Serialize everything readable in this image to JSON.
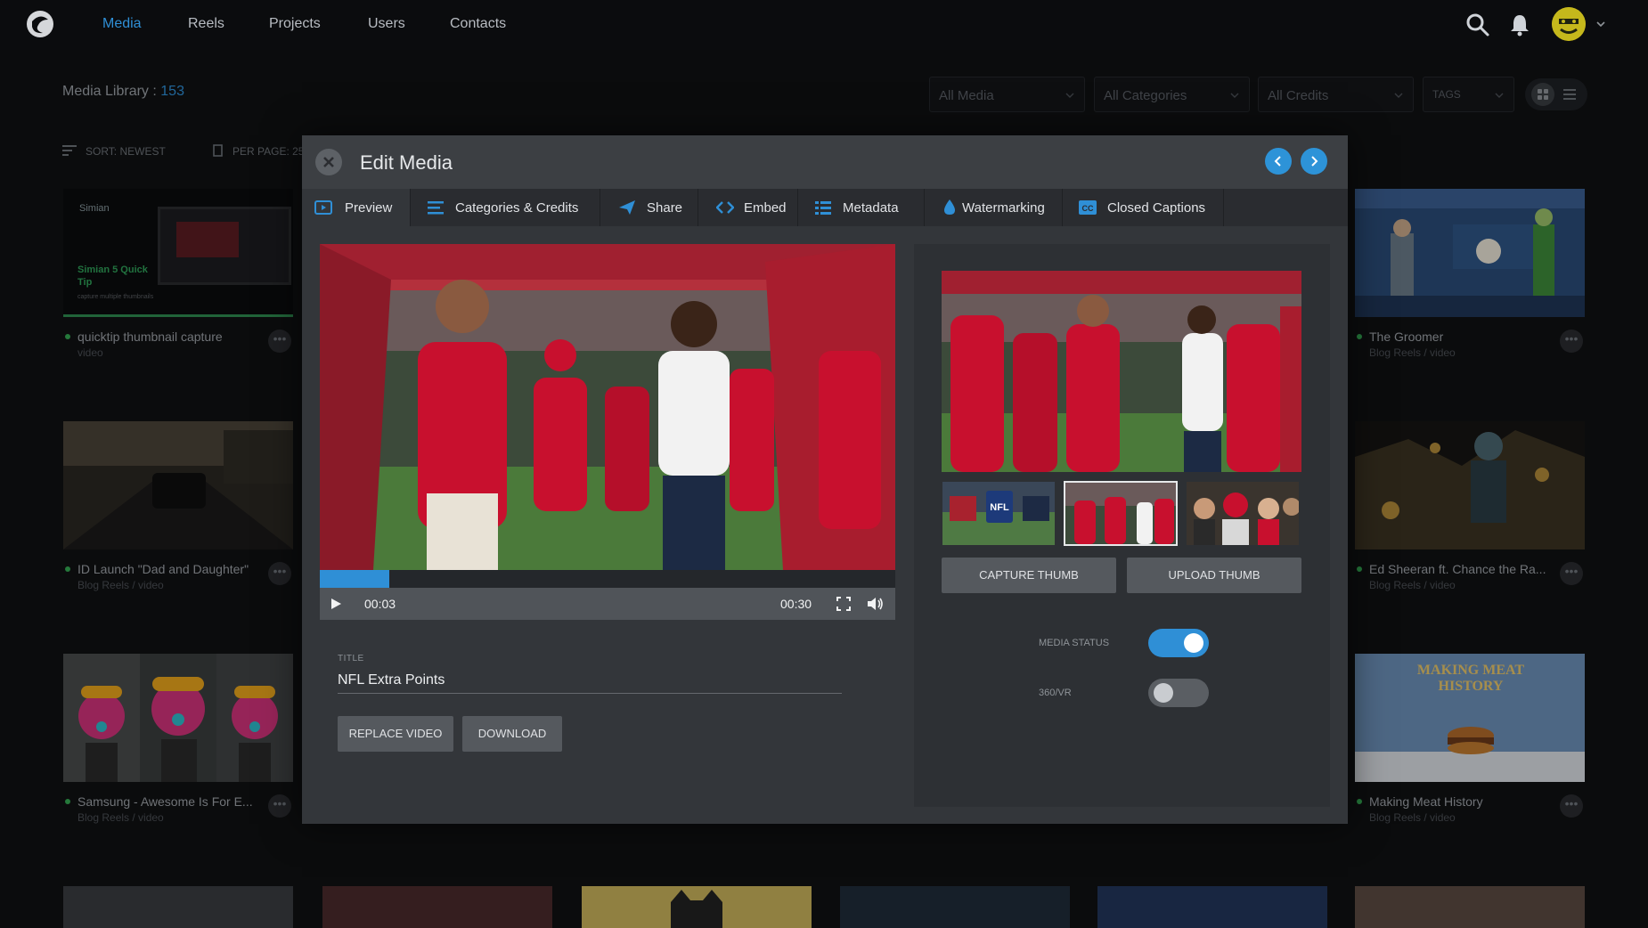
{
  "nav": {
    "items": [
      "Media",
      "Reels",
      "Projects",
      "Users",
      "Contacts"
    ],
    "active": "Media"
  },
  "library": {
    "title": "Media Library",
    "separator": " : ",
    "count": "153",
    "sort": "SORT: NEWEST",
    "per_page": "PER PAGE: 25",
    "filters": [
      "All Media",
      "All Categories",
      "All Credits",
      "TAGS"
    ]
  },
  "cards": {
    "left": [
      {
        "title": "quicktip thumbnail capture",
        "subtitle": "video",
        "thumb_text": "Simian 5 Quick Tip",
        "thumb_caption": "capture multiple thumbnails",
        "brand": "Simian"
      },
      {
        "title": "ID Launch \"Dad and Daughter\"",
        "subtitle": "Blog Reels / video"
      },
      {
        "title": "Samsung - Awesome Is For E...",
        "subtitle": "Blog Reels / video"
      }
    ],
    "right": [
      {
        "title": "The Groomer",
        "subtitle": "Blog Reels / video"
      },
      {
        "title": "Ed Sheeran ft. Chance the Ra...",
        "subtitle": "Blog Reels / video"
      },
      {
        "title": "Making Meat History",
        "subtitle": "Blog Reels / video",
        "thumb_text": "MAKING MEAT HISTORY"
      }
    ],
    "more_glyph": "•••"
  },
  "modal": {
    "title": "Edit Media",
    "tabs": [
      "Preview",
      "Categories & Credits",
      "Share",
      "Embed",
      "Metadata",
      "Watermarking",
      "Closed Captions"
    ],
    "active_tab": "Preview",
    "player": {
      "current_time": "00:03",
      "duration": "00:30",
      "progress": 0.12
    },
    "form": {
      "title_label": "TITLE",
      "title_value": "NFL Extra Points",
      "replace_label": "REPLACE VIDEO",
      "download_label": "DOWNLOAD"
    },
    "thumbs": {
      "capture_label": "CAPTURE THUMB",
      "upload_label": "UPLOAD THUMB",
      "selected_index": 1
    },
    "toggles": {
      "media_status_label": "MEDIA STATUS",
      "media_status_on": true,
      "vr_label": "360/VR",
      "vr_on": false
    }
  },
  "colors": {
    "accent": "#2f8fd6",
    "status_green": "#34a853",
    "kc_red": "#c8102e"
  },
  "icons": [
    "logo-icon",
    "search-icon",
    "bell-icon",
    "chevron-down-icon",
    "grid-view-icon",
    "list-view-icon",
    "close-icon",
    "chevron-left-icon",
    "chevron-right-icon",
    "preview-icon",
    "categories-icon",
    "share-icon",
    "embed-icon",
    "metadata-icon",
    "watermark-icon",
    "closed-captions-icon",
    "play-icon",
    "fullscreen-icon",
    "volume-icon"
  ]
}
